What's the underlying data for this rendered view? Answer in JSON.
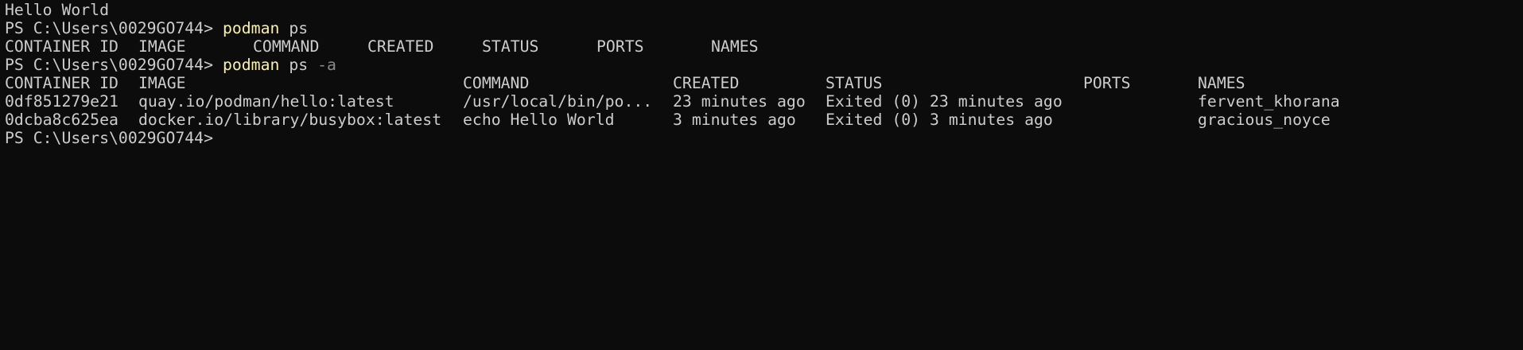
{
  "colors": {
    "background": "#0c0c0c",
    "foreground": "#cccccc",
    "command": "#f9f1a5",
    "parameter": "#8a8a8a"
  },
  "output_line": "Hello World",
  "prompt": "PS C:\\Users\\0029GO744>",
  "cmd1": {
    "exe": "podman",
    "args": "ps"
  },
  "headers_short": [
    "CONTAINER ID",
    "IMAGE",
    "COMMAND",
    "CREATED",
    "STATUS",
    "PORTS",
    "NAMES"
  ],
  "cmd2": {
    "exe": "podman",
    "args": "ps",
    "flag": "-a"
  },
  "headers_full": [
    "CONTAINER ID",
    "IMAGE",
    "COMMAND",
    "CREATED",
    "STATUS",
    "PORTS",
    "NAMES"
  ],
  "rows": [
    {
      "id": "0df851279e21",
      "image": "quay.io/podman/hello:latest",
      "command": "/usr/local/bin/po...",
      "created": "23 minutes ago",
      "status": "Exited (0) 23 minutes ago",
      "ports": "",
      "names": "fervent_khorana"
    },
    {
      "id": "0dcba8c625ea",
      "image": "docker.io/library/busybox:latest",
      "command": "echo Hello World",
      "created": "3 minutes ago",
      "status": "Exited (0) 3 minutes ago",
      "ports": "",
      "names": "gracious_noyce"
    }
  ]
}
